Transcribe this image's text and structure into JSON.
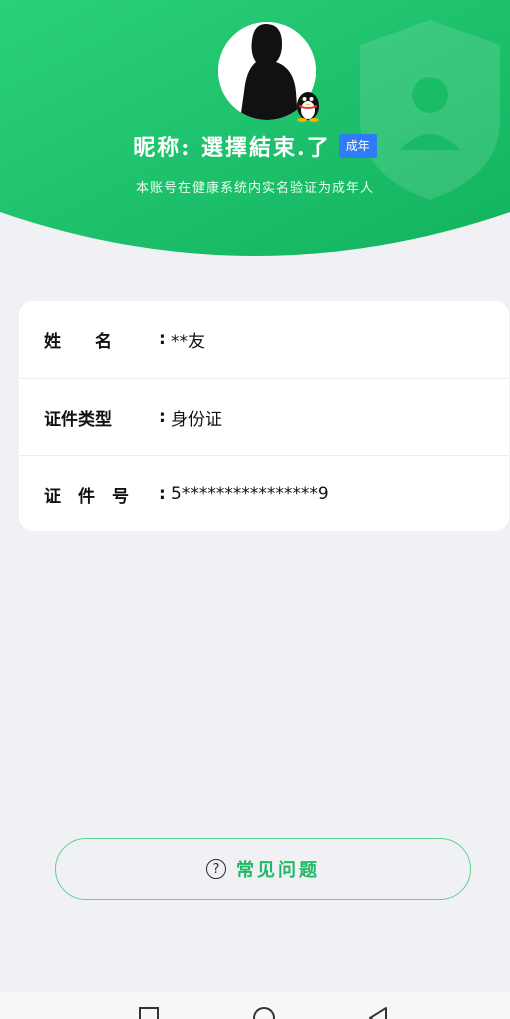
{
  "profile": {
    "nickname": "昵称: 選擇結束.了",
    "age_badge": "成年",
    "verify_note": "本账号在健康系统内实名验证为成年人"
  },
  "info_rows": [
    {
      "label": "姓　　名",
      "colon": ":",
      "value": "**友"
    },
    {
      "label": "证件类型",
      "colon": ":",
      "value": "身份证"
    },
    {
      "label": "证　件　号",
      "colon": ":",
      "value": "5****************9"
    }
  ],
  "faq": {
    "label": "常见问题",
    "icon_glyph": "?"
  },
  "colors": {
    "header_green": "#1fc26a",
    "badge_blue": "#2f7cf6",
    "faq_text": "#1fb964"
  },
  "icons": [
    "shield-icon",
    "qq-penguin-icon",
    "question-icon",
    "nav-square-icon",
    "nav-circle-icon",
    "nav-back-icon"
  ]
}
